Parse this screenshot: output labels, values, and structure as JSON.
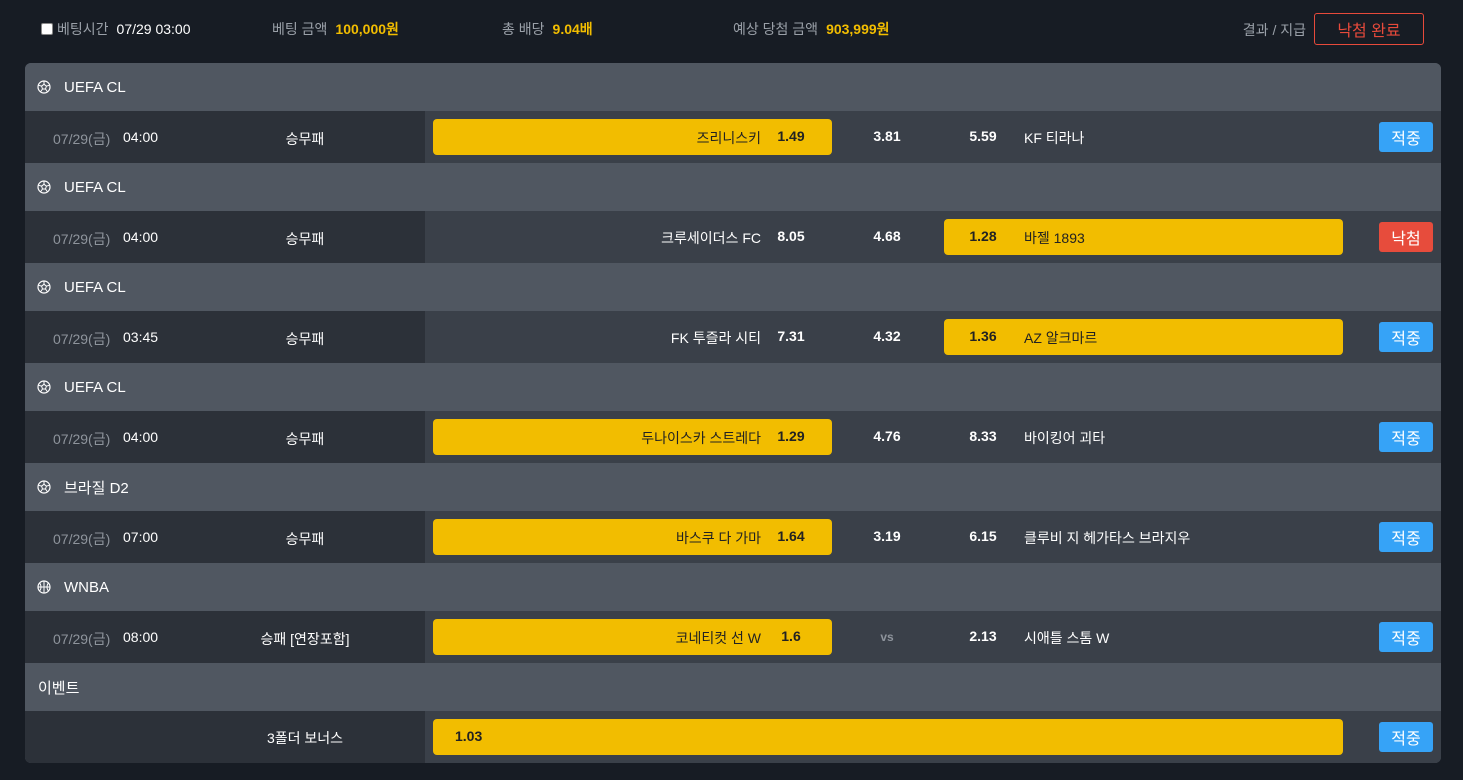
{
  "header": {
    "bet_time_label": "베팅시간",
    "bet_time_value": "07/29 03:00",
    "bet_amount_label": "베팅 금액",
    "bet_amount_value": "100,000원",
    "total_odds_label": "총 배당",
    "total_odds_value": "9.04배",
    "expected_win_label": "예상 당첨 금액",
    "expected_win_value": "903,999원",
    "result_label": "결과 / 지급",
    "status_button": "낙첨 완료"
  },
  "colors": {
    "selected": "#f2bd00",
    "hit_badge": "#36a3f7",
    "miss_badge": "#e74c3c",
    "status_outline": "#e74a3b"
  },
  "bets": [
    {
      "league": "UEFA CL",
      "icon": "soccer-ball-icon",
      "date": "07/29(금)",
      "time": "04:00",
      "type": "승무패",
      "home": "즈리니스키",
      "home_odd": "1.49",
      "draw": "3.81",
      "away_odd": "5.59",
      "away": "KF 티라나",
      "selected": "home",
      "result": "적중",
      "result_kind": "hit"
    },
    {
      "league": "UEFA CL",
      "icon": "soccer-ball-icon",
      "date": "07/29(금)",
      "time": "04:00",
      "type": "승무패",
      "home": "크루세이더스 FC",
      "home_odd": "8.05",
      "draw": "4.68",
      "away_odd": "1.28",
      "away": "바젤 1893",
      "selected": "away",
      "result": "낙첨",
      "result_kind": "miss"
    },
    {
      "league": "UEFA CL",
      "icon": "soccer-ball-icon",
      "date": "07/29(금)",
      "time": "03:45",
      "type": "승무패",
      "home": "FK 투즐라 시티",
      "home_odd": "7.31",
      "draw": "4.32",
      "away_odd": "1.36",
      "away": "AZ 알크마르",
      "selected": "away",
      "result": "적중",
      "result_kind": "hit"
    },
    {
      "league": "UEFA CL",
      "icon": "soccer-ball-icon",
      "date": "07/29(금)",
      "time": "04:00",
      "type": "승무패",
      "home": "두나이스카 스트레다",
      "home_odd": "1.29",
      "draw": "4.76",
      "away_odd": "8.33",
      "away": "바이킹어 괴타",
      "selected": "home",
      "result": "적중",
      "result_kind": "hit"
    },
    {
      "league": "브라질 D2",
      "icon": "soccer-ball-icon",
      "date": "07/29(금)",
      "time": "07:00",
      "type": "승무패",
      "home": "바스쿠 다 가마",
      "home_odd": "1.64",
      "draw": "3.19",
      "away_odd": "6.15",
      "away": "클루비 지 헤가타스 브라지우",
      "selected": "home",
      "result": "적중",
      "result_kind": "hit"
    },
    {
      "league": "WNBA",
      "icon": "basketball-icon",
      "date": "07/29(금)",
      "time": "08:00",
      "type": "승패 [연장포함]",
      "home": "코네티컷 선 W",
      "home_odd": "1.6",
      "draw": "vs",
      "away_odd": "2.13",
      "away": "시애틀 스톰 W",
      "selected": "home",
      "result": "적중",
      "result_kind": "hit"
    }
  ],
  "event": {
    "title": "이벤트",
    "label": "3폴더 보너스",
    "odd": "1.03",
    "result": "적중"
  }
}
